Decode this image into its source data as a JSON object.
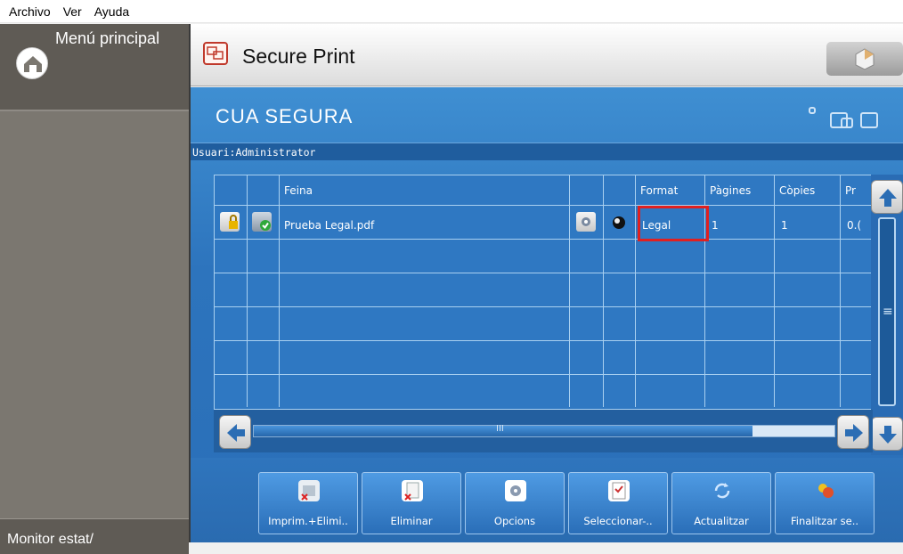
{
  "menubar": {
    "items": [
      "Archivo",
      "Ver",
      "Ayuda"
    ]
  },
  "sidebar": {
    "home_label": "Menú principal",
    "bottom_label": "Monitor estat/"
  },
  "header": {
    "title": "Secure Print"
  },
  "main": {
    "title": "CUA SEGURA",
    "user_label": "Usuari:Administrator"
  },
  "table": {
    "columns": [
      "Feina",
      "Format",
      "Pàgines",
      "Còpies",
      "Pr"
    ],
    "rows": [
      {
        "job": "Prueba Legal.pdf",
        "format": "Legal",
        "pages": "1",
        "copies": "1",
        "pr": "0.("
      }
    ]
  },
  "hscroll": {
    "grip": "III"
  },
  "vscroll": {
    "grip": "≡"
  },
  "toolbar": {
    "buttons": [
      "Imprim.+Elimi..",
      "Eliminar",
      "Opcions",
      "Seleccionar-..",
      "Actualitzar",
      "Finalitzar se.."
    ]
  },
  "colors": {
    "main_blue": "#2d74bd",
    "highlight_red": "#e02020",
    "sidebar_gray": "#7b7770"
  }
}
